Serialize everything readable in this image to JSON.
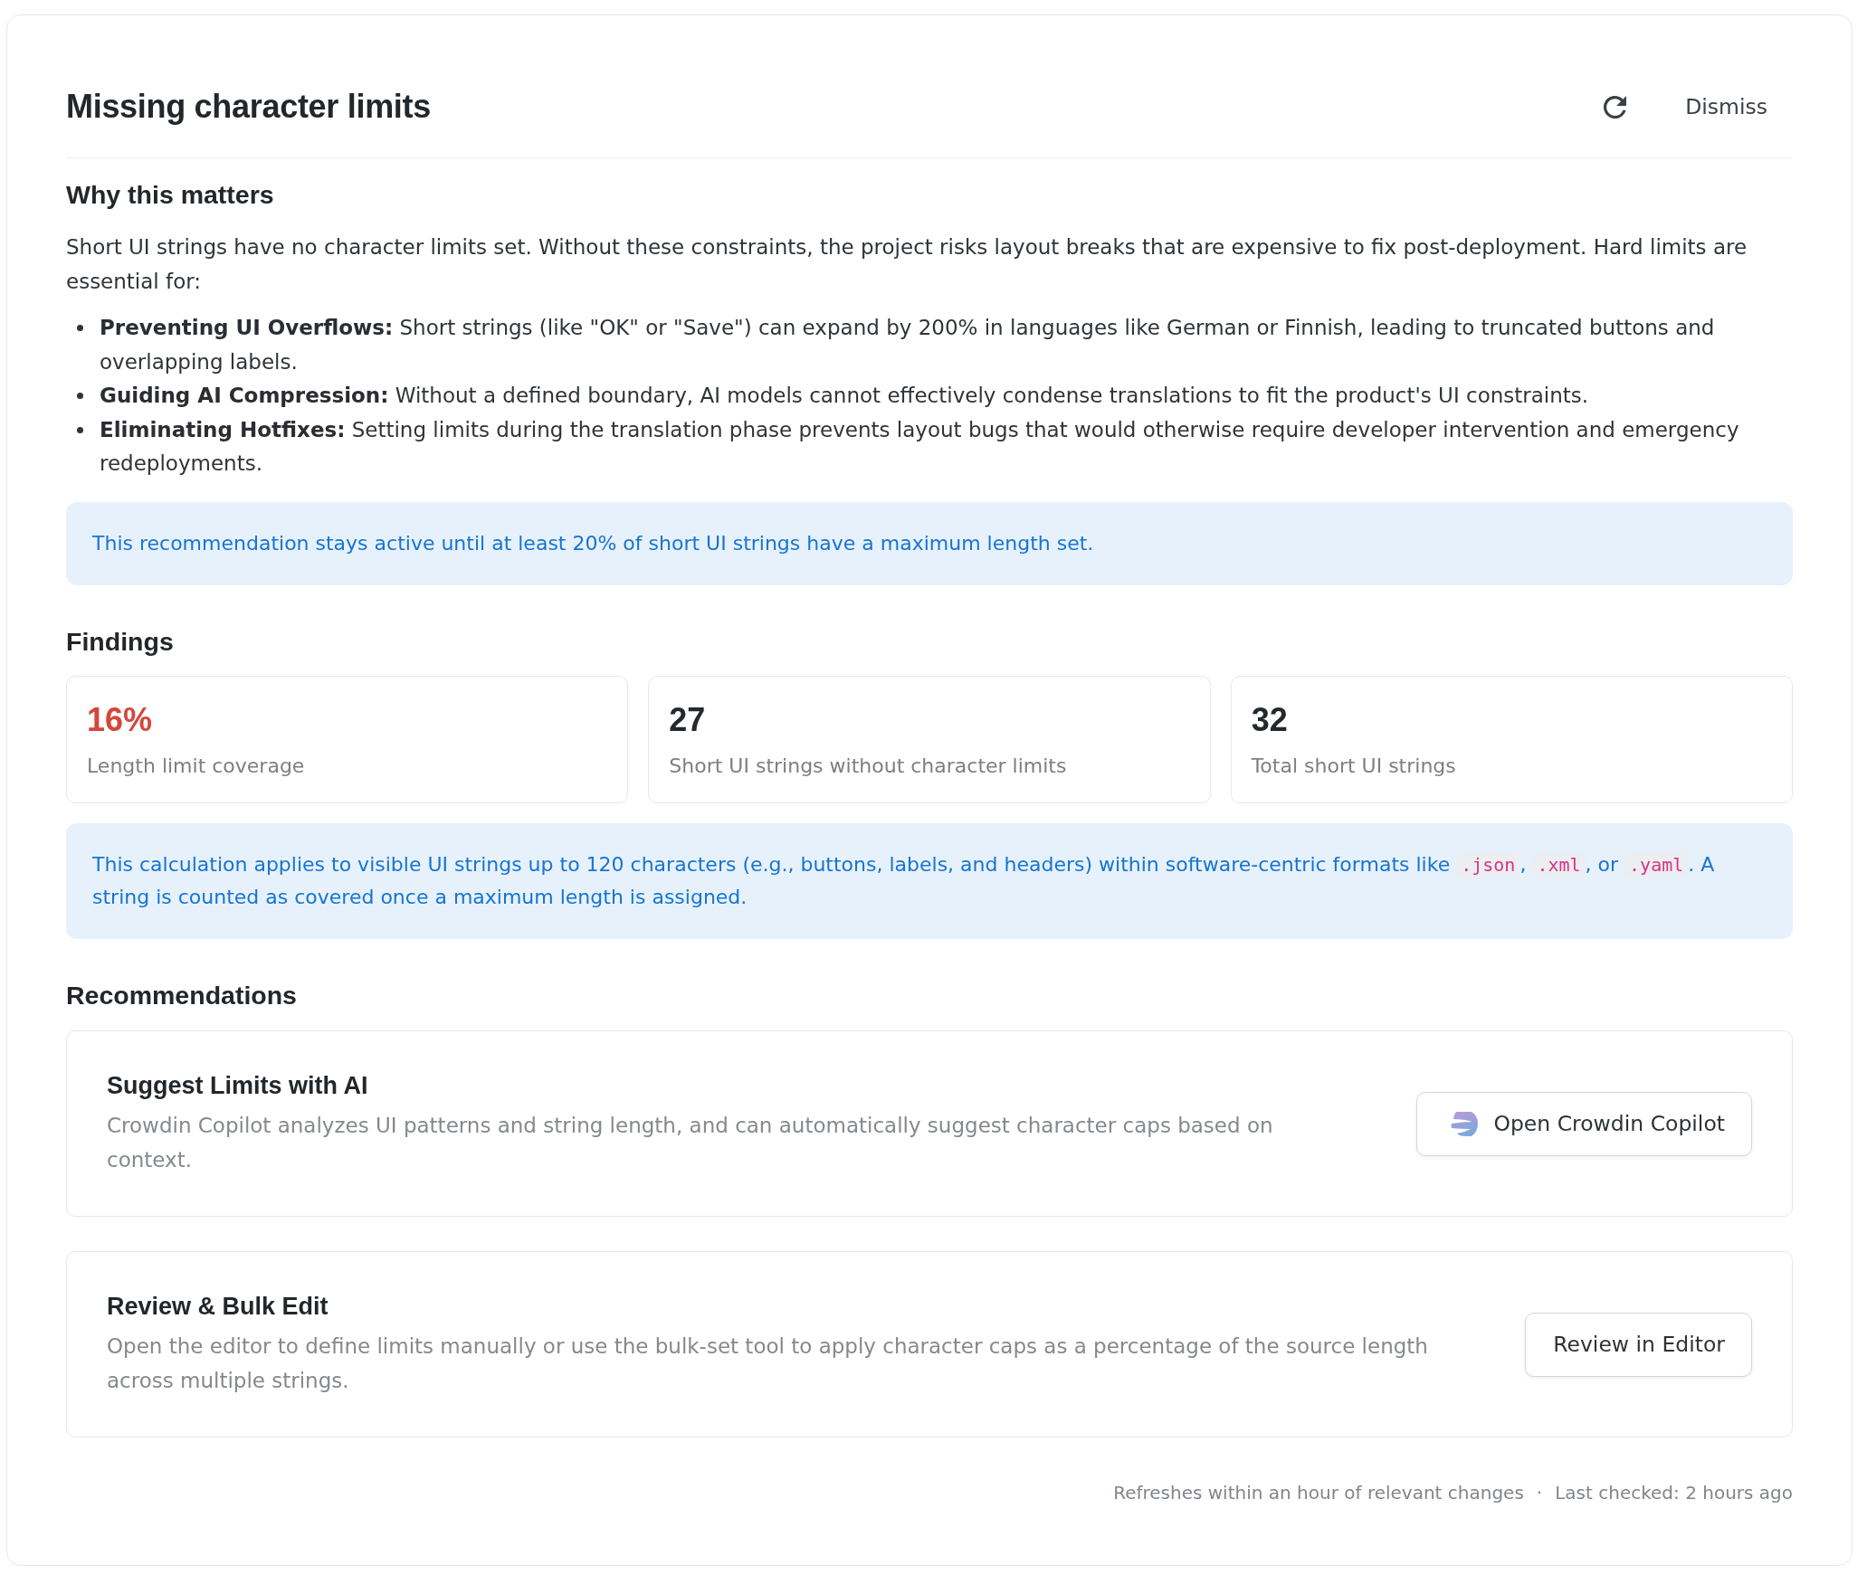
{
  "header": {
    "title": "Missing character limits",
    "dismiss": "Dismiss"
  },
  "why": {
    "heading": "Why this matters",
    "intro": "Short UI strings have no character limits set. Without these constraints, the project risks layout breaks that are expensive to fix post-deployment. Hard limits are essential for:",
    "bullets": [
      "**Preventing UI Overflows:** Short strings (like \"OK\" or \"Save\") can expand by 200% in languages like German or Finnish, leading to truncated buttons and overlapping labels.",
      "**Guiding AI Compression:** Without a defined boundary, AI models cannot effectively condense translations to fit the product's UI constraints.",
      "**Eliminating Hotfixes:** Setting limits during the translation phase prevents layout bugs that would otherwise require developer intervention and emergency redeployments."
    ],
    "note": "This recommendation stays active until at least 20% of short UI strings have a maximum length set."
  },
  "findings": {
    "heading": "Findings",
    "stats": [
      {
        "value": "16%",
        "label": "Length limit coverage",
        "color": "#d4473a"
      },
      {
        "value": "27",
        "label": "Short UI strings without character limits",
        "color": "#24292e"
      },
      {
        "value": "32",
        "label": "Total short UI strings",
        "color": "#24292e"
      }
    ],
    "note": [
      {
        "kind": "text",
        "text": "This calculation applies to visible UI strings up to 120 characters (e.g., buttons, labels, and headers) within software-centric formats like "
      },
      {
        "kind": "code",
        "text": ".json"
      },
      {
        "kind": "text",
        "text": ", "
      },
      {
        "kind": "code",
        "text": ".xml"
      },
      {
        "kind": "text",
        "text": ", or "
      },
      {
        "kind": "code",
        "text": ".yaml"
      },
      {
        "kind": "text",
        "text": ". A string is counted as covered once a maximum length is assigned."
      }
    ]
  },
  "recommendations": {
    "heading": "Recommendations",
    "items": [
      {
        "title": "Suggest Limits with AI",
        "description": "Crowdin Copilot analyzes UI patterns and string length, and can automatically suggest character caps based on context.",
        "button": {
          "kind": "logo",
          "label": "Open Crowdin Copilot"
        }
      },
      {
        "title": "Review & Bulk Edit",
        "description": "Open the editor to define limits manually or use the bulk-set tool to apply character caps as a percentage of the source length across multiple strings.",
        "button": {
          "kind": "plain",
          "label": "Review in Editor"
        }
      }
    ]
  },
  "footer": {
    "refresh_note": "Refreshes within an hour of relevant changes",
    "separator": "·",
    "last_checked": "Last checked: 2 hours ago"
  }
}
